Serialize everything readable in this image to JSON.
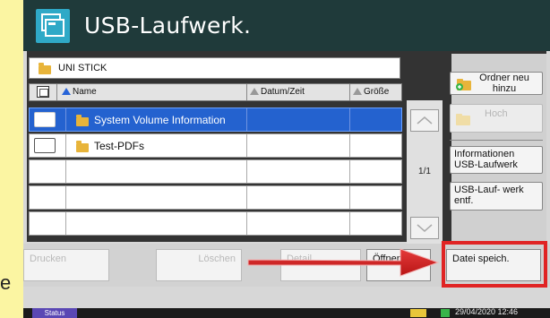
{
  "window": {
    "title": "USB-Laufwerk."
  },
  "path": {
    "label": "UNI STICK"
  },
  "columns": {
    "name": "Name",
    "date": "Datum/Zeit",
    "size": "Größe"
  },
  "files": [
    {
      "name": "System Volume Information",
      "selected": true
    },
    {
      "name": "Test-PDFs",
      "selected": false
    }
  ],
  "pager": {
    "page": "1/1"
  },
  "side": {
    "new_folder": "Ordner neu hinzu",
    "up": "Hoch",
    "info": "Informationen USB-Laufwerk",
    "remove": "USB-Lauf- werk entf."
  },
  "bottom": {
    "print": "Drucken",
    "delete": "Löschen",
    "detail": "Detail",
    "open": "Öffnen",
    "save": "Datei speich."
  },
  "status": {
    "tab": "Status",
    "datetime": "29/04/2020  12:46"
  },
  "stray": {
    "letter": "e"
  },
  "colors": {
    "header_bg": "#1f3a3a",
    "selection": "#2462cf",
    "highlight": "#e02424",
    "background": "#fbf5a2"
  },
  "icons": {
    "app": "usb-drive-icon",
    "folder": "folder-icon",
    "add_folder": "add-folder-icon",
    "up": "up-folder-icon",
    "scroll_up": "chevron-up-icon",
    "scroll_down": "chevron-down-icon"
  }
}
